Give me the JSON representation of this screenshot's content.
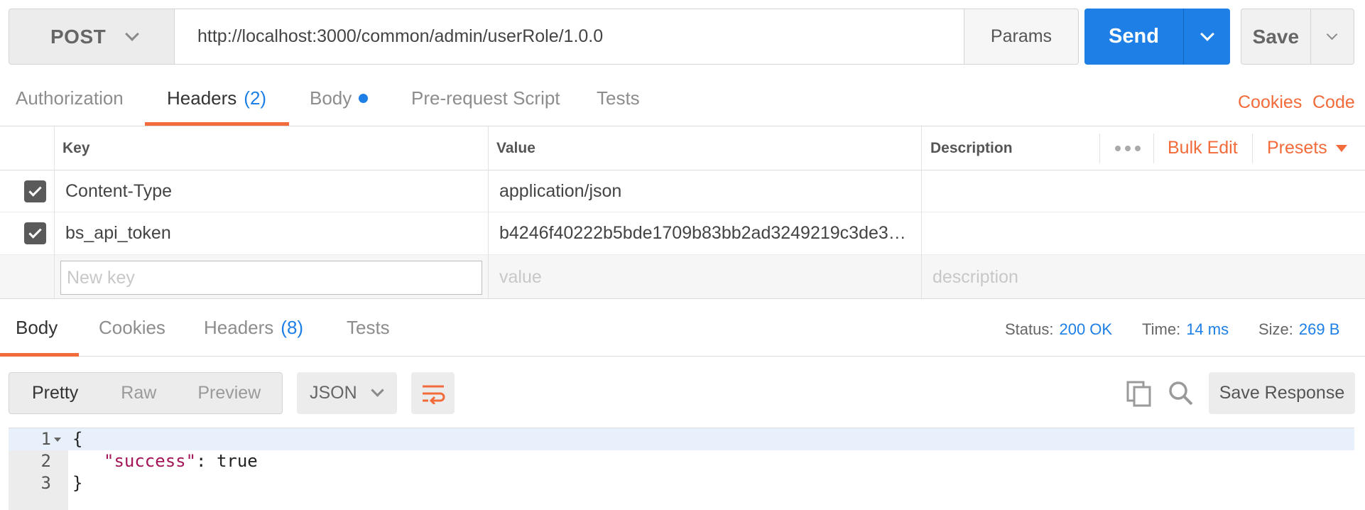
{
  "request": {
    "method": "POST",
    "url": "http://localhost:3000/common/admin/userRole/1.0.0",
    "params_label": "Params",
    "send_label": "Send",
    "save_label": "Save"
  },
  "request_tabs": {
    "authorization": "Authorization",
    "headers": "Headers",
    "headers_count": "(2)",
    "body": "Body",
    "prerequest": "Pre-request Script",
    "tests": "Tests",
    "cookies_link": "Cookies",
    "code_link": "Code"
  },
  "headers_table": {
    "columns": {
      "key": "Key",
      "value": "Value",
      "description": "Description"
    },
    "bulk_edit": "Bulk Edit",
    "presets": "Presets",
    "rows": [
      {
        "key": "Content-Type",
        "value": "application/json",
        "description": "",
        "checked": true
      },
      {
        "key": "bs_api_token",
        "value": "b4246f40222b5bde1709b83bb2ad3249219c3de3…",
        "description": "",
        "checked": true
      }
    ],
    "new_row": {
      "key_placeholder": "New key",
      "value_placeholder": "value",
      "description_placeholder": "description"
    }
  },
  "response_tabs": {
    "body": "Body",
    "cookies": "Cookies",
    "headers": "Headers",
    "headers_count": "(8)",
    "tests": "Tests"
  },
  "response_status": {
    "status_label": "Status:",
    "status_value": "200 OK",
    "time_label": "Time:",
    "time_value": "14 ms",
    "size_label": "Size:",
    "size_value": "269 B"
  },
  "response_toolbar": {
    "pretty": "Pretty",
    "raw": "Raw",
    "preview": "Preview",
    "format": "JSON",
    "save_response": "Save Response"
  },
  "response_body": {
    "lines": [
      {
        "num": "1",
        "open": "{"
      },
      {
        "num": "2",
        "key": "\"success\"",
        "rest": ": true"
      },
      {
        "num": "3",
        "close": "}"
      }
    ]
  },
  "colors": {
    "accent_blue": "#1e7fe6",
    "accent_orange": "#f26b3a"
  }
}
